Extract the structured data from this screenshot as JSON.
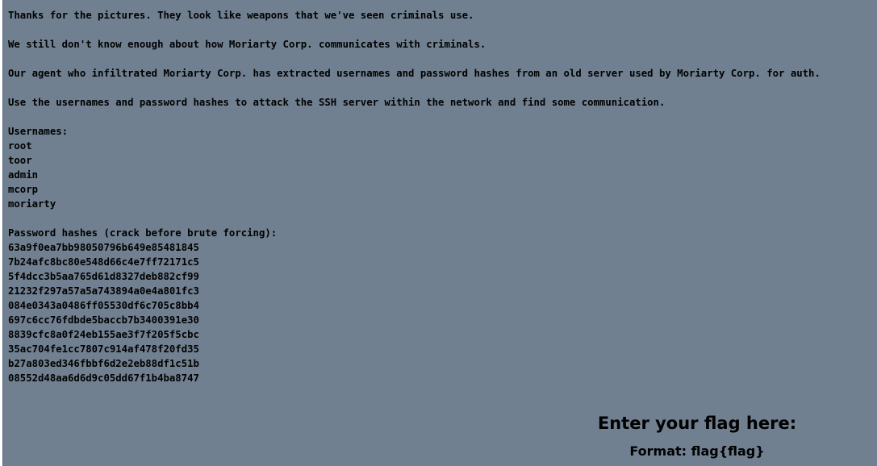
{
  "message": {
    "intro_1": "Thanks for the pictures. They look like weapons that we've seen criminals use.",
    "intro_2": "We still don't know enough about how Moriarty Corp. communicates with criminals.",
    "intro_3": "Our agent who infiltrated Moriarty Corp. has extracted usernames and password hashes from an old server used by Moriarty Corp. for auth.",
    "intro_4": "Use the usernames and password hashes to attack the SSH server within the network and find some communication.",
    "usernames_heading": "Usernames:",
    "usernames": [
      "root",
      "toor",
      "admin",
      "mcorp",
      "moriarty"
    ],
    "hashes_heading": "Password hashes (crack before brute forcing):",
    "hashes": [
      "63a9f0ea7bb98050796b649e85481845",
      "7b24afc8bc80e548d66c4e7ff72171c5",
      "5f4dcc3b5aa765d61d8327deb882cf99",
      "21232f297a57a5a743894a0e4a801fc3",
      "084e0343a0486ff05530df6c705c8bb4",
      "697c6cc76fdbde5baccb7b3400391e30",
      "8839cfc8a0f24eb155ae3f7f205f5cbc",
      "35ac704fe1cc7807c914af478f20fd35",
      "b27a803ed346fbbf6d2e2eb88df1c51b",
      "08552d48aa6d6d9c05dd67f1b4ba8747"
    ]
  },
  "flag_form": {
    "title": "Enter your flag here:",
    "format": "Format: flag{flag}"
  },
  "colors": {
    "background": "#708090",
    "text": "#000000"
  }
}
